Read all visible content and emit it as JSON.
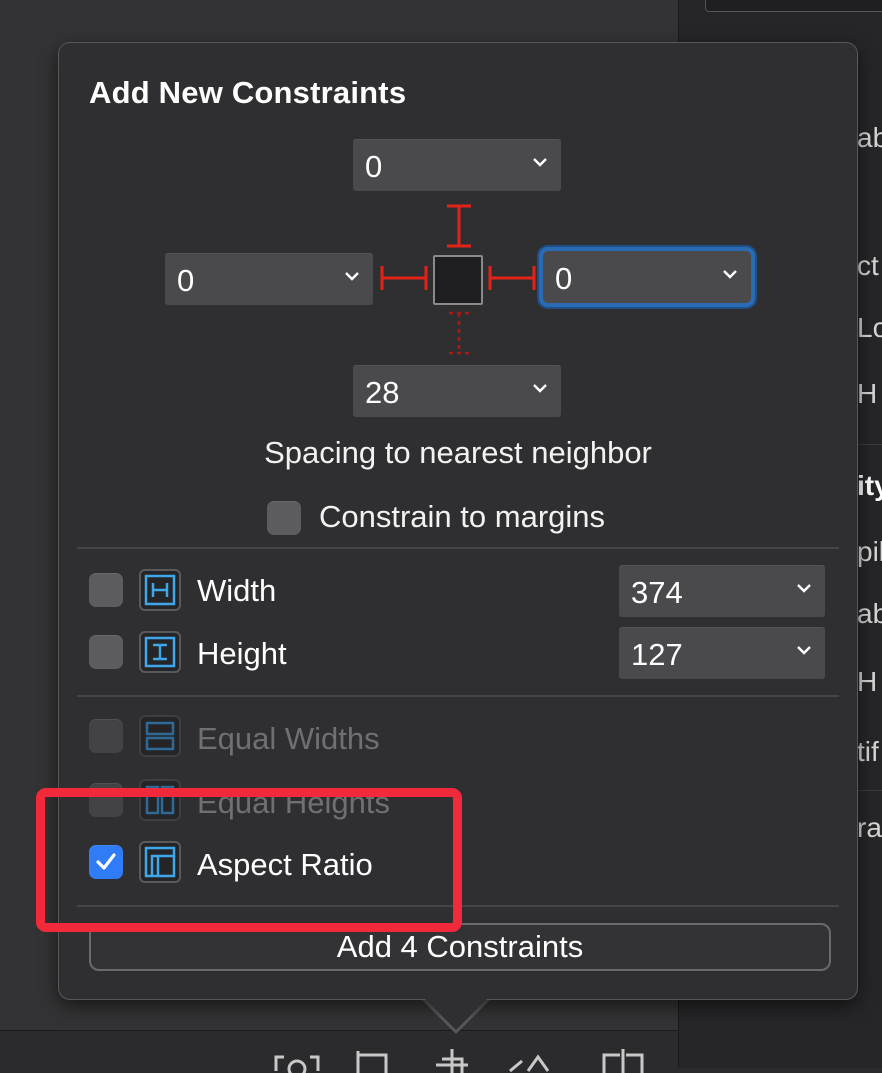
{
  "popover": {
    "title": "Add New Constraints",
    "spacing": {
      "top": "0",
      "left": "0",
      "right": "0",
      "bottom": "28"
    },
    "spacing_caption": "Spacing to nearest neighbor",
    "constrain_to_margins": {
      "label": "Constrain to margins",
      "checked": false
    },
    "size": [
      {
        "label": "Width",
        "value": "374",
        "checked": false,
        "icon": "width-icon"
      },
      {
        "label": "Height",
        "value": "127",
        "checked": false,
        "icon": "height-icon"
      }
    ],
    "relations": [
      {
        "label": "Equal Widths",
        "checked": false,
        "enabled": false,
        "icon": "equal-widths-icon"
      },
      {
        "label": "Equal Heights",
        "checked": false,
        "enabled": false,
        "icon": "equal-heights-icon"
      },
      {
        "label": "Aspect Ratio",
        "checked": true,
        "enabled": true,
        "icon": "aspect-ratio-icon"
      }
    ],
    "add_button": "Add 4 Constraints"
  },
  "inspector_fragments": [
    "ab",
    "ct",
    "Lo",
    "H",
    "ity",
    "pil",
    "ab",
    "H",
    "tif",
    "ra"
  ],
  "colors": {
    "strut": "#e2231a",
    "accent": "#2f7cf6",
    "highlight": "#f02a3a",
    "icon": "#3fa6ea"
  }
}
